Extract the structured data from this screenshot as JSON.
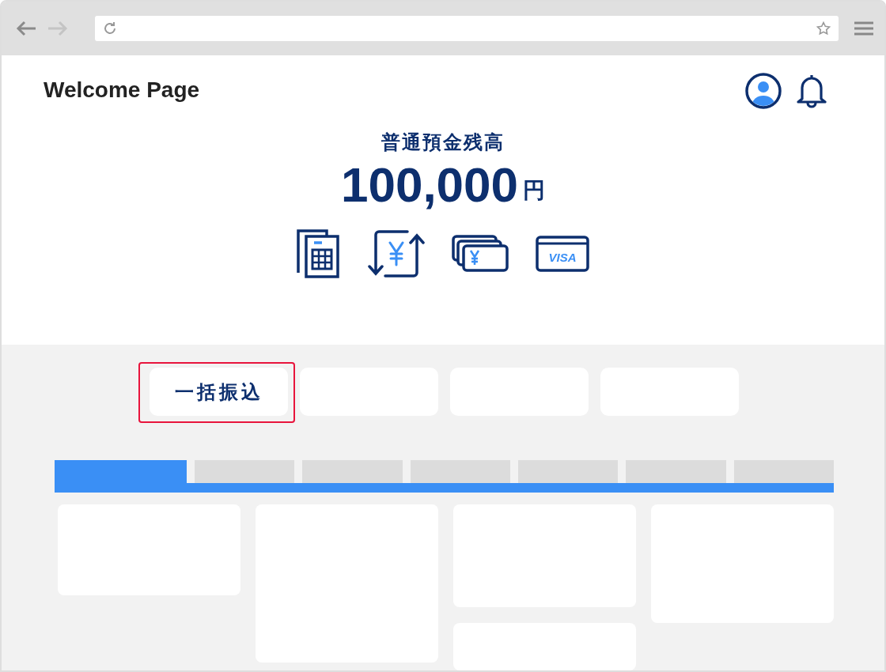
{
  "browser": {
    "back_disabled": false,
    "forward_disabled": true
  },
  "header": {
    "title": "Welcome Page"
  },
  "balance": {
    "label": "普通預金残高",
    "amount": "100,000",
    "unit": "円"
  },
  "shortcuts": [
    {
      "kind": "statement"
    },
    {
      "kind": "transfer"
    },
    {
      "kind": "cash"
    },
    {
      "kind": "card",
      "text": "VISA"
    }
  ],
  "quick_buttons": [
    {
      "label": "一括振込",
      "highlighted": true
    },
    {
      "highlighted": false
    },
    {
      "highlighted": false
    },
    {
      "highlighted": false
    }
  ],
  "tabs": [
    {
      "selected": true
    },
    {
      "selected": false
    },
    {
      "selected": false
    },
    {
      "selected": false
    },
    {
      "selected": false
    },
    {
      "selected": false
    },
    {
      "selected": false
    }
  ]
}
